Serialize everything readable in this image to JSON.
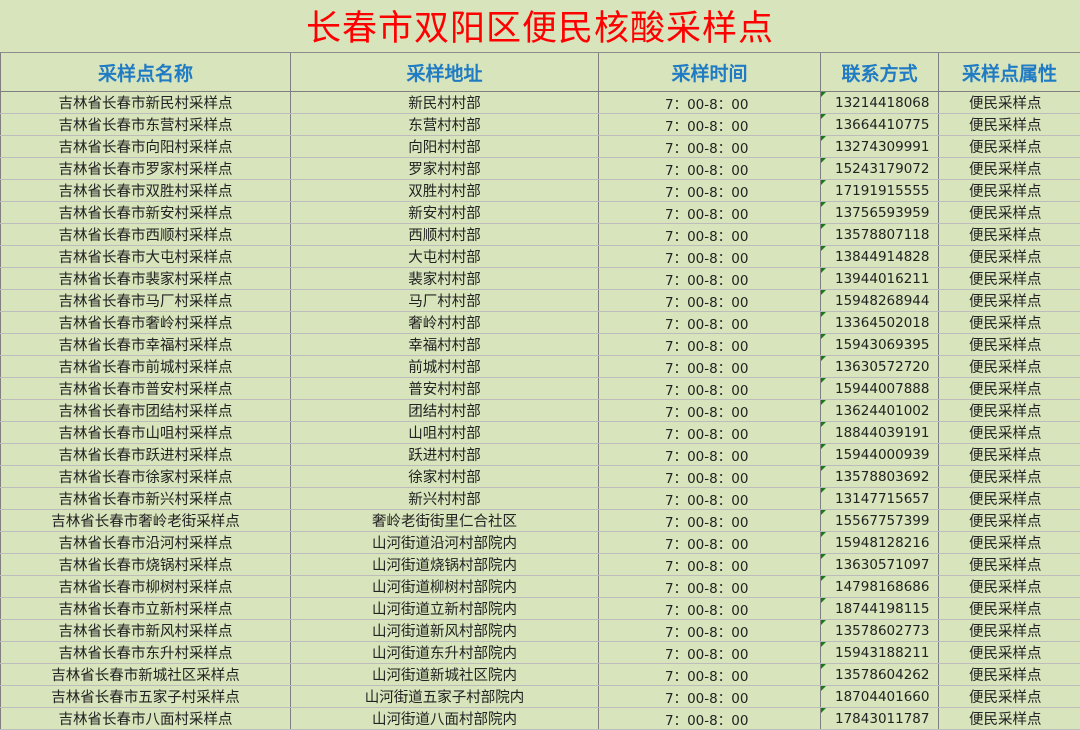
{
  "title": "长春市双阳区便民核酸采样点",
  "headers": [
    "采样点名称",
    "采样地址",
    "采样时间",
    "联系方式",
    "采样点属性"
  ],
  "rows": [
    {
      "name": "吉林省长春市新民村采样点",
      "address": "新民村村部",
      "time": "7：00-8：00",
      "phone": "13214418068",
      "attr": "便民采样点"
    },
    {
      "name": "吉林省长春市东营村采样点",
      "address": "东营村村部",
      "time": "7：00-8：00",
      "phone": "13664410775",
      "attr": "便民采样点"
    },
    {
      "name": "吉林省长春市向阳村采样点",
      "address": "向阳村村部",
      "time": "7：00-8：00",
      "phone": "13274309991",
      "attr": "便民采样点"
    },
    {
      "name": "吉林省长春市罗家村采样点",
      "address": "罗家村村部",
      "time": "7：00-8：00",
      "phone": "15243179072",
      "attr": "便民采样点"
    },
    {
      "name": "吉林省长春市双胜村采样点",
      "address": "双胜村村部",
      "time": "7：00-8：00",
      "phone": "17191915555",
      "attr": "便民采样点"
    },
    {
      "name": "吉林省长春市新安村采样点",
      "address": "新安村村部",
      "time": "7：00-8：00",
      "phone": "13756593959",
      "attr": "便民采样点"
    },
    {
      "name": "吉林省长春市西顺村采样点",
      "address": "西顺村村部",
      "time": "7：00-8：00",
      "phone": "13578807118",
      "attr": "便民采样点"
    },
    {
      "name": "吉林省长春市大屯村采样点",
      "address": "大屯村村部",
      "time": "7：00-8：00",
      "phone": "13844914828",
      "attr": "便民采样点"
    },
    {
      "name": "吉林省长春市裴家村采样点",
      "address": "裴家村村部",
      "time": "7：00-8：00",
      "phone": "13944016211",
      "attr": "便民采样点"
    },
    {
      "name": "吉林省长春市马厂村采样点",
      "address": "马厂村村部",
      "time": "7：00-8：00",
      "phone": "15948268944",
      "attr": "便民采样点"
    },
    {
      "name": "吉林省长春市奢岭村采样点",
      "address": "奢岭村村部",
      "time": "7：00-8：00",
      "phone": "13364502018",
      "attr": "便民采样点"
    },
    {
      "name": "吉林省长春市幸福村采样点",
      "address": "幸福村村部",
      "time": "7：00-8：00",
      "phone": "15943069395",
      "attr": "便民采样点"
    },
    {
      "name": "吉林省长春市前城村采样点",
      "address": "前城村村部",
      "time": "7：00-8：00",
      "phone": "13630572720",
      "attr": "便民采样点"
    },
    {
      "name": "吉林省长春市普安村采样点",
      "address": "普安村村部",
      "time": "7：00-8：00",
      "phone": "15944007888",
      "attr": "便民采样点"
    },
    {
      "name": "吉林省长春市团结村采样点",
      "address": "团结村村部",
      "time": "7：00-8：00",
      "phone": "13624401002",
      "attr": "便民采样点"
    },
    {
      "name": "吉林省长春市山咀村采样点",
      "address": "山咀村村部",
      "time": "7：00-8：00",
      "phone": "18844039191",
      "attr": "便民采样点"
    },
    {
      "name": "吉林省长春市跃进村采样点",
      "address": "跃进村村部",
      "time": "7：00-8：00",
      "phone": "15944000939",
      "attr": "便民采样点"
    },
    {
      "name": "吉林省长春市徐家村采样点",
      "address": "徐家村村部",
      "time": "7：00-8：00",
      "phone": "13578803692",
      "attr": "便民采样点"
    },
    {
      "name": "吉林省长春市新兴村采样点",
      "address": "新兴村村部",
      "time": "7：00-8：00",
      "phone": "13147715657",
      "attr": "便民采样点"
    },
    {
      "name": "吉林省长春市奢岭老街采样点",
      "address": "奢岭老街街里仁合社区",
      "time": "7：00-8：00",
      "phone": "15567757399",
      "attr": "便民采样点"
    },
    {
      "name": "吉林省长春市沿河村采样点",
      "address": "山河街道沿河村部院内",
      "time": "7：00-8：00",
      "phone": "15948128216",
      "attr": "便民采样点"
    },
    {
      "name": "吉林省长春市烧锅村采样点",
      "address": "山河街道烧锅村部院内",
      "time": "7：00-8：00",
      "phone": "13630571097",
      "attr": "便民采样点"
    },
    {
      "name": "吉林省长春市柳树村采样点",
      "address": "山河街道柳树村部院内",
      "time": "7：00-8：00",
      "phone": "14798168686",
      "attr": "便民采样点"
    },
    {
      "name": "吉林省长春市立新村采样点",
      "address": "山河街道立新村部院内",
      "time": "7：00-8：00",
      "phone": "18744198115",
      "attr": "便民采样点"
    },
    {
      "name": "吉林省长春市新风村采样点",
      "address": "山河街道新风村部院内",
      "time": "7：00-8：00",
      "phone": "13578602773",
      "attr": "便民采样点"
    },
    {
      "name": "吉林省长春市东升村采样点",
      "address": "山河街道东升村部院内",
      "time": "7：00-8：00",
      "phone": "15943188211",
      "attr": "便民采样点"
    },
    {
      "name": "吉林省长春市新城社区采样点",
      "address": "山河街道新城社区院内",
      "time": "7：00-8：00",
      "phone": "13578604262",
      "attr": "便民采样点"
    },
    {
      "name": "吉林省长春市五家子村采样点",
      "address": "山河街道五家子村部院内",
      "time": "7：00-8：00",
      "phone": "18704401660",
      "attr": "便民采样点"
    },
    {
      "name": "吉林省长春市八面村采样点",
      "address": "山河街道八面村部院内",
      "time": "7：00-8：00",
      "phone": "17843011787",
      "attr": "便民采样点"
    }
  ]
}
